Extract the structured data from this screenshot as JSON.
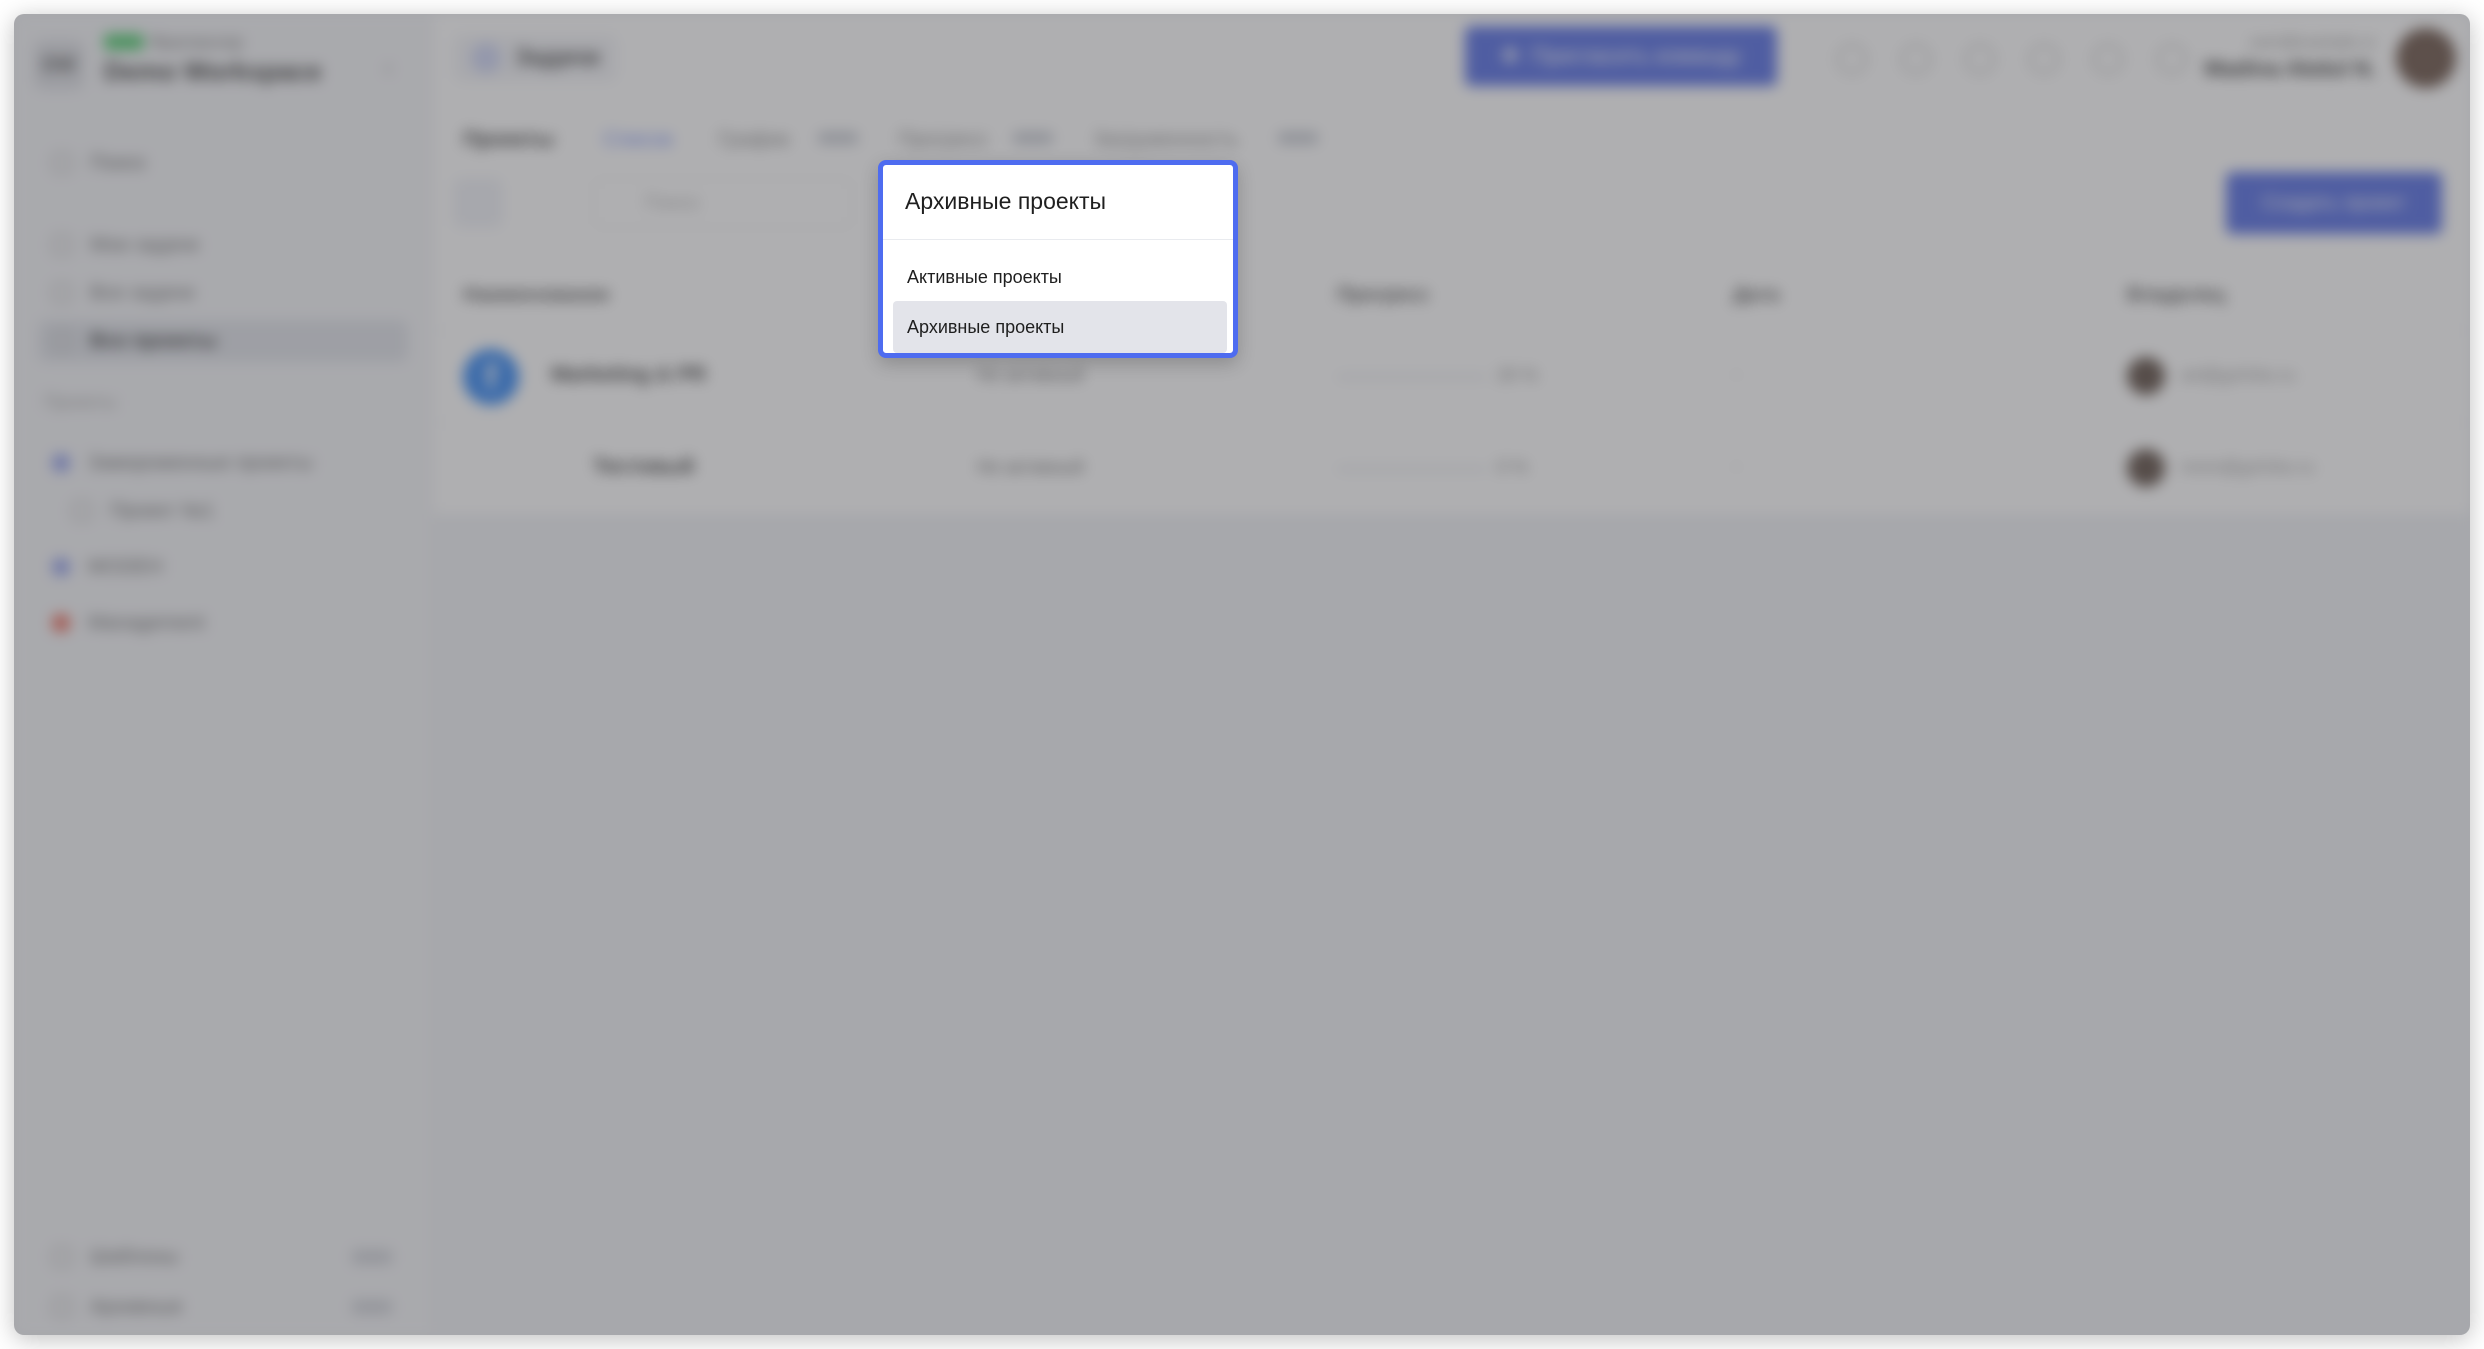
{
  "app": {
    "workspace": {
      "initials": "DW",
      "label": "Фрилансер",
      "name": "Demo Workspace"
    },
    "sidebar": {
      "search": "Поиск",
      "nav": [
        "Мои задачи",
        "Все задачи",
        "Все проекты"
      ],
      "group_title": "Проекты",
      "projects": [
        "Замороженные проекты",
        "Проект №1",
        "MODEH",
        "Management"
      ],
      "footer": [
        "Шаблоны",
        "Архивные"
      ]
    },
    "header": {
      "tab": "Задачи",
      "invite_button": "Пригласить команду",
      "user_email": "user@example.ru",
      "user_name": "Madina Abdul N."
    },
    "subnav": [
      "Проекты",
      "Список",
      "График",
      "Прогресс",
      "Загруженность"
    ],
    "toolbar": {
      "search_placeholder": "Поиск",
      "create_button": "Создать проект"
    },
    "table": {
      "columns": [
        "Наименование",
        "Прогресс",
        "Дата",
        "Владелец"
      ],
      "rows": [
        {
          "name": "Marketing & PR",
          "status": "Не активный",
          "progress": "20 %",
          "date": "-",
          "owner": "art@gvhrbs.ru"
        },
        {
          "name": "Тестовый",
          "status": "Не активный",
          "progress": "0 %",
          "date": "-",
          "owner": "mnm@gvhrbs.ru"
        }
      ]
    }
  },
  "dropdown": {
    "selected_value": "Архивные проекты",
    "options": [
      "Активные проекты",
      "Архивные проекты"
    ],
    "accent_color": "#4e6cf0"
  }
}
